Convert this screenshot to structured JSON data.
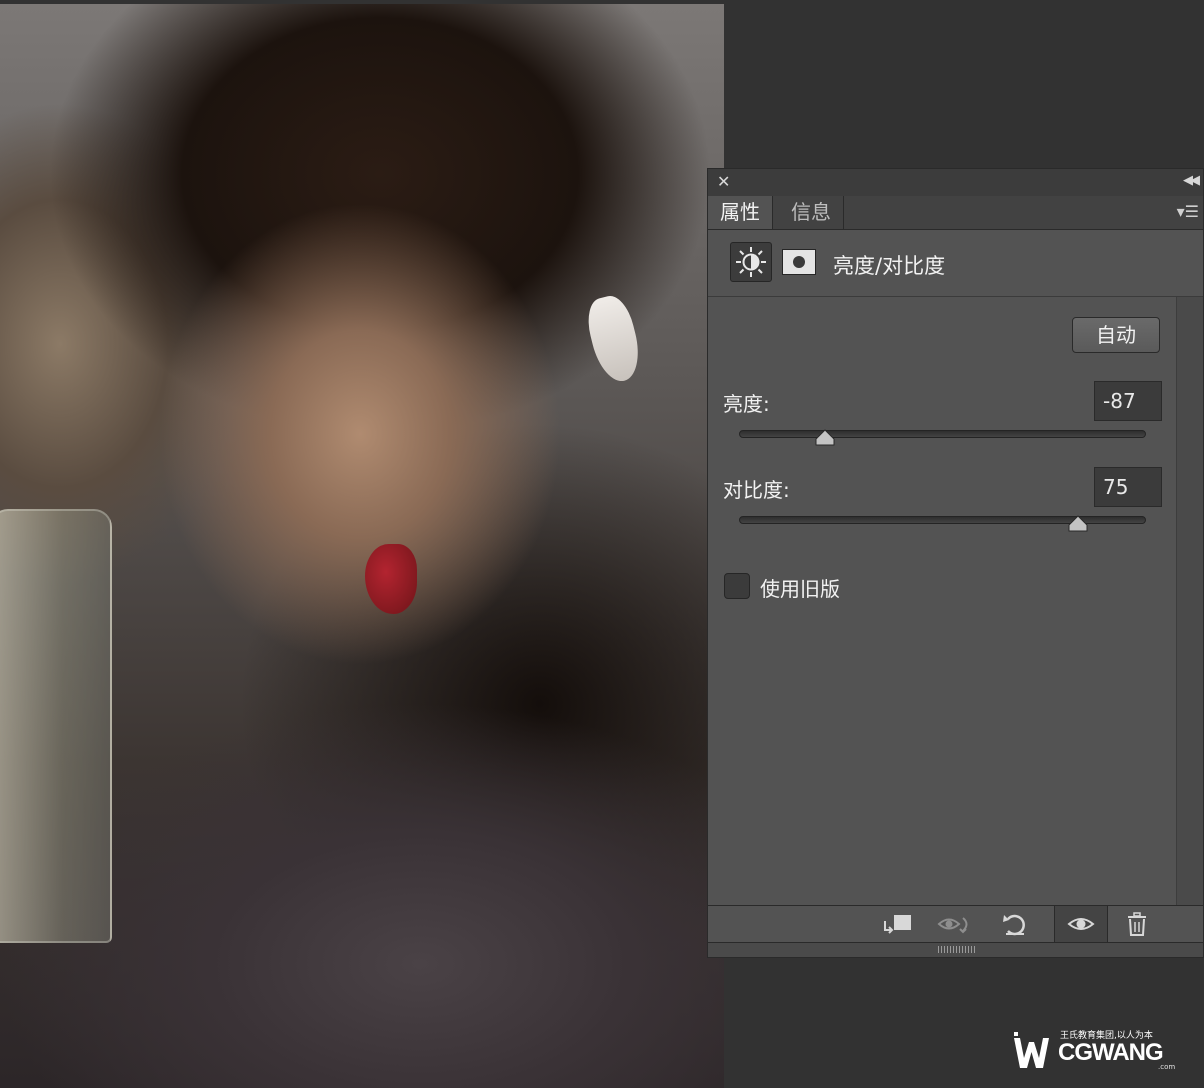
{
  "panel": {
    "tabs": [
      {
        "label": "属性",
        "active": true
      },
      {
        "label": "信息",
        "active": false
      }
    ],
    "close_icon": "close-icon",
    "collapse_icon": "double-chevron-left-icon",
    "menu_icon": "panel-menu-icon",
    "adjustment_title": "亮度/对比度",
    "auto_label": "自动",
    "brightness": {
      "label": "亮度:",
      "value": "-87",
      "min": -150,
      "max": 150,
      "current": -87
    },
    "contrast": {
      "label": "对比度:",
      "value": "75",
      "min": -50,
      "max": 100,
      "current": 75
    },
    "legacy": {
      "label": "使用旧版",
      "checked": false
    },
    "footer_icons": [
      "clip-to-layer-icon",
      "view-previous-state-icon",
      "reset-icon",
      "visibility-eye-icon",
      "trash-icon"
    ]
  },
  "watermark": {
    "tagline": "王氏教育集团,以人为本",
    "brand": "CGWANG",
    "domain_suffix": ".com"
  },
  "colors": {
    "panel_bg": "#535353",
    "workspace_bg": "#323232",
    "lip_red": "#b32430"
  }
}
